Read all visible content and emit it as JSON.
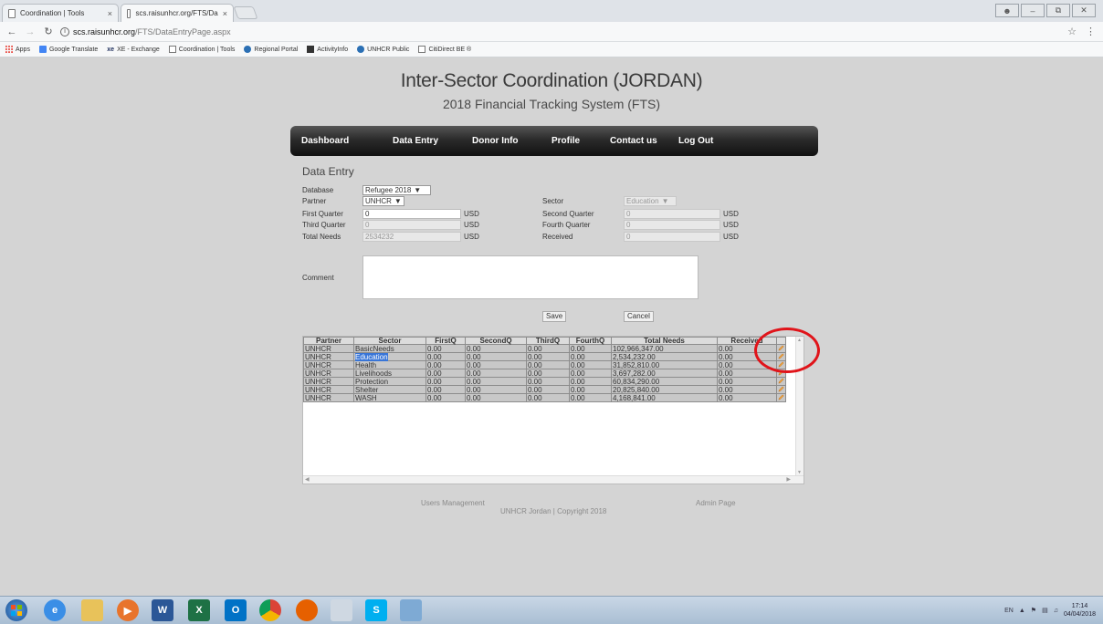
{
  "browser": {
    "tabs": [
      {
        "title": "Coordination | Tools",
        "close": "×"
      },
      {
        "title": "scs.raisunhcr.org/FTS/Da",
        "close": "×"
      }
    ],
    "url_host": "scs.raisunhcr.org",
    "url_path": "/FTS/DataEntryPage.aspx",
    "bookmarks": [
      "Apps",
      "Google Translate",
      "XE - Exchange",
      "Coordination | Tools",
      "Regional Portal",
      "ActivityInfo",
      "UNHCR Public",
      "CitiDirect BE ®"
    ]
  },
  "page": {
    "title": "Inter-Sector Coordination (JORDAN)",
    "subtitle": "2018 Financial Tracking System (FTS)",
    "nav": [
      "Dashboard",
      "Data Entry",
      "Donor Info",
      "Profile",
      "Contact us",
      "Log Out"
    ],
    "section_title": "Data Entry"
  },
  "form": {
    "database_label": "Database",
    "database_value": "Refugee 2018",
    "partner_label": "Partner",
    "partner_value": "UNHCR",
    "sector_label": "Sector",
    "sector_value": "Education",
    "first_quarter_label": "First Quarter",
    "first_quarter_value": "0",
    "second_quarter_label": "Second Quarter",
    "second_quarter_value": "0",
    "third_quarter_label": "Third Quarter",
    "third_quarter_value": "0",
    "fourth_quarter_label": "Fourth Quarter",
    "fourth_quarter_value": "0",
    "total_needs_label": "Total Needs",
    "total_needs_value": "2534232",
    "received_label": "Received",
    "received_value": "0",
    "currency": "USD",
    "comment_label": "Comment",
    "save_label": "Save",
    "cancel_label": "Cancel"
  },
  "grid": {
    "columns": [
      "Partner",
      "Sector",
      "FirstQ",
      "SecondQ",
      "ThirdQ",
      "FourthQ",
      "Total Needs",
      "Received"
    ],
    "rows": [
      [
        "UNHCR",
        "BasicNeeds",
        "0.00",
        "0.00",
        "0.00",
        "0.00",
        "102,966,347.00",
        "0.00"
      ],
      [
        "UNHCR",
        "Education",
        "0.00",
        "0.00",
        "0.00",
        "0.00",
        "2,534,232.00",
        "0.00"
      ],
      [
        "UNHCR",
        "Health",
        "0.00",
        "0.00",
        "0.00",
        "0.00",
        "31,852,810.00",
        "0.00"
      ],
      [
        "UNHCR",
        "Livelihoods",
        "0.00",
        "0.00",
        "0.00",
        "0.00",
        "3,697,282.00",
        "0.00"
      ],
      [
        "UNHCR",
        "Protection",
        "0.00",
        "0.00",
        "0.00",
        "0.00",
        "60,834,290.00",
        "0.00"
      ],
      [
        "UNHCR",
        "Shelter",
        "0.00",
        "0.00",
        "0.00",
        "0.00",
        "20,825,840.00",
        "0.00"
      ],
      [
        "UNHCR",
        "WASH",
        "0.00",
        "0.00",
        "0.00",
        "0.00",
        "4,168,841.00",
        "0.00"
      ]
    ],
    "selected_sector": "Education",
    "row_action_icon": "pencil-icon"
  },
  "footer": {
    "users_management": "Users Management",
    "copyright": "UNHCR Jordan | Copyright 2018",
    "admin_page": "Admin Page"
  },
  "taskbar": {
    "language": "EN",
    "time": "17:14",
    "date": "04/04/2018"
  },
  "colors": {
    "page_bg": "#d4d4d4",
    "navbar": "#2b2b2b",
    "annotation": "#e0141a",
    "selection": "#3875d7"
  }
}
